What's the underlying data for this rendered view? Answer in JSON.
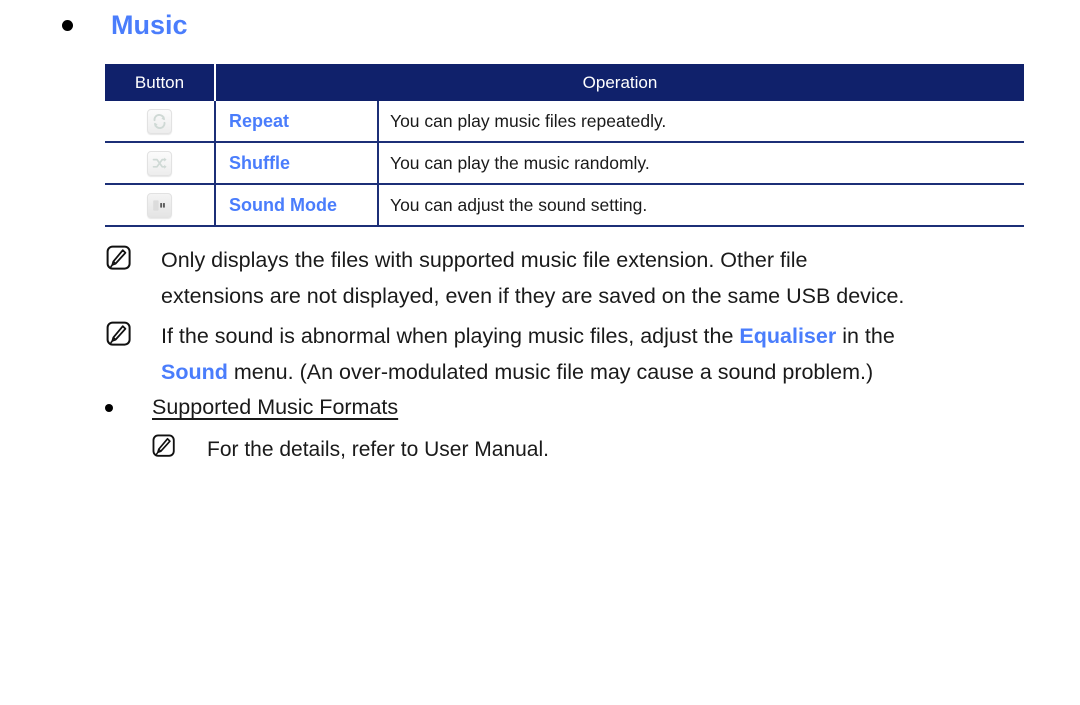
{
  "heading": {
    "bullet_icon": "bullet-dot-icon",
    "title": "Music",
    "color": "#4a7dfc"
  },
  "table": {
    "headers": {
      "button": "Button",
      "operation": "Operation"
    },
    "header_bg": "#10216b",
    "border_color": "#1c2f77",
    "label_color": "#4a7dfc",
    "rows": [
      {
        "icon": "repeat-icon",
        "label": "Repeat",
        "operation": "You can play music files repeatedly."
      },
      {
        "icon": "shuffle-icon",
        "label": "Shuffle",
        "operation": "You can play the music randomly."
      },
      {
        "icon": "sound-mode-icon",
        "label": "Sound Mode",
        "operation": "You can adjust the sound setting."
      }
    ]
  },
  "notes": [
    {
      "icon": "note-pen-icon",
      "line1": "Only displays the files with supported music file extension. Other file",
      "line2": "extensions are not displayed, even if they are saved on the same USB device."
    },
    {
      "icon": "note-pen-icon",
      "line1_a": "If the sound is abnormal when playing music files, adjust the ",
      "line1_kw": "Equaliser",
      "line1_b": " in the",
      "line2_kw": "Sound",
      "line2_b": " menu. (An over-modulated music file may cause a sound problem.)"
    }
  ],
  "subsection": {
    "bullet_icon": "bullet-dot-icon",
    "title": "Supported Music Formats",
    "note": {
      "icon": "note-pen-icon",
      "text": "For the details, refer to User Manual."
    }
  }
}
